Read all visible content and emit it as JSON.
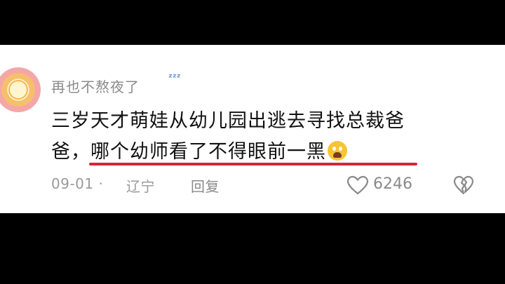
{
  "comment": {
    "username": "再也不熬夜了",
    "username_icon": "zzz-icon",
    "text_line1": "三岁天才萌娃从幼儿园出逃去寻找总裁爸",
    "text_line2_prefix": "爸，",
    "text_line2_highlight": "哪个幼师看了不得眼前一黑",
    "emoji": "scared-face-emoji",
    "underline_color": "#d8243a"
  },
  "meta": {
    "date": "09-01",
    "separator": "·",
    "location": "辽宁",
    "reply_label": "回复",
    "like_count": "6246"
  }
}
